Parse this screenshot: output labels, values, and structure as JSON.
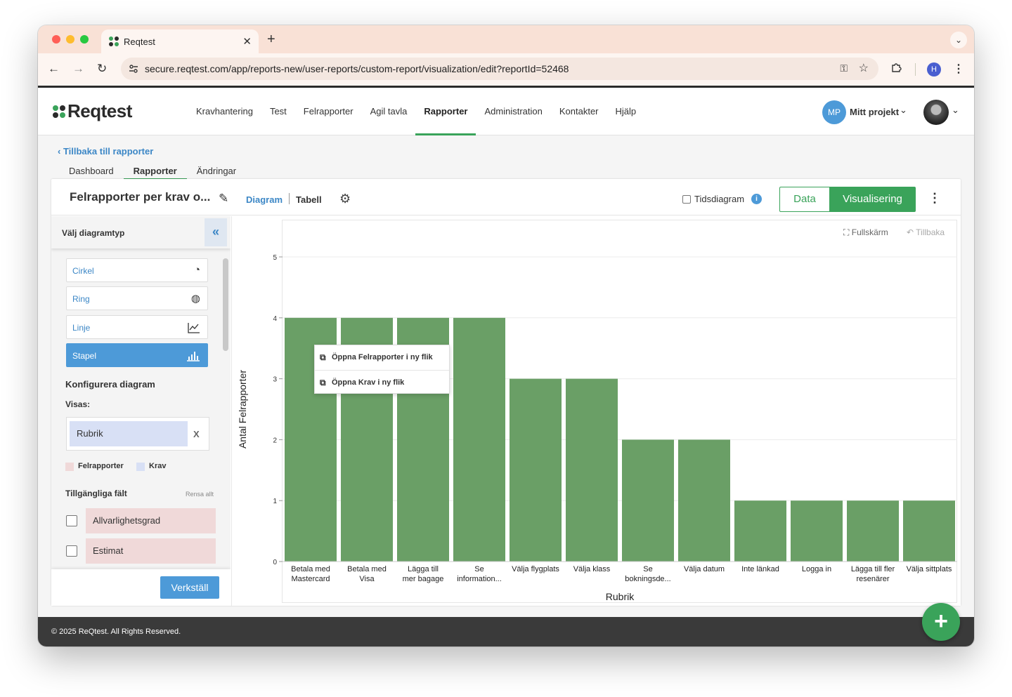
{
  "browser": {
    "tab_title": "Reqtest",
    "url": "secure.reqtest.com/app/reports-new/user-reports/custom-report/visualization/edit?reportId=52468",
    "profile_initial": "H"
  },
  "app": {
    "logo_text": "Reqtest",
    "nav": [
      "Kravhantering",
      "Test",
      "Felrapporter",
      "Agil tavla",
      "Rapporter",
      "Administration",
      "Kontakter",
      "Hjälp"
    ],
    "active_nav": "Rapporter",
    "project_initials": "MP",
    "project_name": "Mitt projekt"
  },
  "subnav": {
    "back": "Tillbaka till rapporter",
    "tabs": [
      "Dashboard",
      "Rapporter",
      "Ändringar"
    ],
    "active_tab": "Rapporter"
  },
  "report": {
    "title": "Felrapporter per krav o...",
    "view_diagram": "Diagram",
    "view_table": "Tabell",
    "time_diagram": "Tidsdiagram",
    "btn_data": "Data",
    "btn_vis": "Visualisering"
  },
  "panel": {
    "header": "Välj diagramtyp",
    "types": [
      {
        "label": "Cirkel",
        "icon": "pie-chart-icon"
      },
      {
        "label": "Ring",
        "icon": "ring-chart-icon"
      },
      {
        "label": "Linje",
        "icon": "line-chart-icon"
      },
      {
        "label": "Stapel",
        "icon": "bar-chart-icon"
      }
    ],
    "active_type": "Stapel",
    "config_title": "Konfigurera diagram",
    "visas_label": "Visas:",
    "visas_value": "Rubrik",
    "visas_remove": "X",
    "legend": [
      {
        "label": "Felrapporter",
        "color": "#f0d9d9"
      },
      {
        "label": "Krav",
        "color": "#d8e0f5"
      }
    ],
    "available_title": "Tillgängliga fält",
    "clear_all": "Rensa allt",
    "fields": [
      "Allvarlighetsgrad",
      "Estimat"
    ],
    "apply": "Verkställ"
  },
  "chart_controls": {
    "fullscreen": "Fullskärm",
    "undo": "Tillbaka"
  },
  "context_menu": {
    "items": [
      "Öppna Felrapporter i ny flik",
      "Öppna Krav i ny flik"
    ]
  },
  "chart_data": {
    "type": "bar",
    "categories": [
      [
        "Betala med",
        "Mastercard"
      ],
      [
        "Betala med",
        "Visa"
      ],
      [
        "Lägga till",
        "mer bagage"
      ],
      [
        "Se",
        "information..."
      ],
      [
        "Välja flygplats"
      ],
      [
        "Välja klass"
      ],
      [
        "Se",
        "bokningsde..."
      ],
      [
        "Välja datum"
      ],
      [
        "Inte länkad"
      ],
      [
        "Logga in"
      ],
      [
        "Lägga till fler",
        "resenärer"
      ],
      [
        "Välja sittplats"
      ]
    ],
    "values": [
      4,
      4,
      4,
      4,
      3,
      3,
      2,
      2,
      1,
      1,
      1,
      1
    ],
    "xlabel": "Rubrik",
    "ylabel": "Antal Felrapporter",
    "ylim": [
      0,
      5
    ],
    "yticks": [
      0,
      1,
      2,
      3,
      4,
      5
    ],
    "bar_color": "#6a9f66",
    "grid": true
  },
  "footer": {
    "copyright": "© 2025 ReQtest. All Rights Reserved."
  }
}
